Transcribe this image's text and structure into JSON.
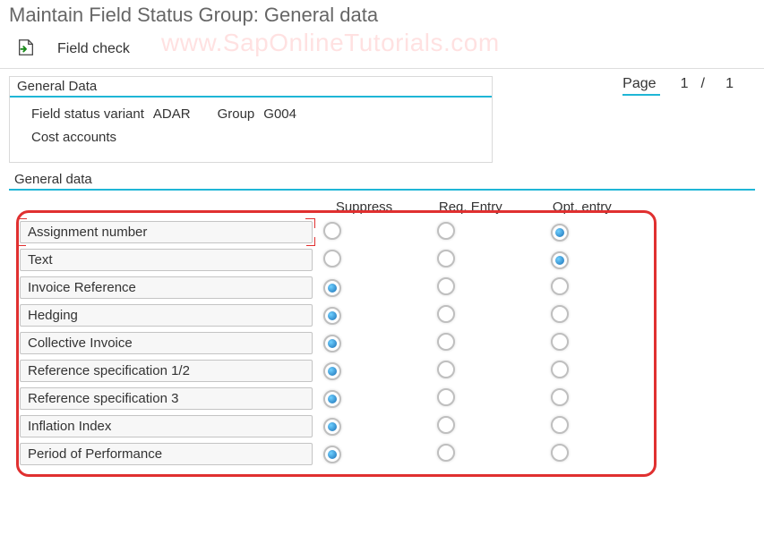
{
  "title": "Maintain Field Status Group: General data",
  "toolbar": {
    "field_check_label": "Field check"
  },
  "watermark": "www.SapOnlineTutorials.com",
  "general_panel": {
    "header": "General Data",
    "variant_label": "Field status variant",
    "variant_value": "ADAR",
    "group_label": "Group",
    "group_value": "G004",
    "description": "Cost accounts"
  },
  "page_indicator": {
    "label": "Page",
    "current": "1",
    "sep": "/",
    "total": "1"
  },
  "grid": {
    "header": "General data",
    "columns": {
      "suppress": "Suppress",
      "req": "Req. Entry",
      "opt": "Opt. entry"
    },
    "rows": [
      {
        "label": "Assignment number",
        "value": "opt"
      },
      {
        "label": "Text",
        "value": "opt"
      },
      {
        "label": "Invoice Reference",
        "value": "suppress"
      },
      {
        "label": "Hedging",
        "value": "suppress"
      },
      {
        "label": "Collective Invoice",
        "value": "suppress"
      },
      {
        "label": "Reference specification 1/2",
        "value": "suppress"
      },
      {
        "label": "Reference specification 3",
        "value": "suppress"
      },
      {
        "label": "Inflation Index",
        "value": "suppress"
      },
      {
        "label": "Period of Performance",
        "value": "suppress"
      }
    ]
  }
}
